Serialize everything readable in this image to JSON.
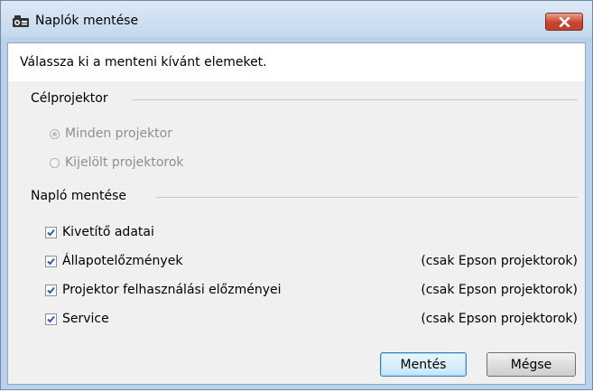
{
  "window": {
    "title": "Naplók mentése"
  },
  "instruction": "Válassza ki a menteni kívánt elemeket.",
  "target_group": {
    "label": "Célprojektor",
    "options": [
      {
        "label": "Minden projektor",
        "checked": true,
        "enabled": false
      },
      {
        "label": "Kijelölt projektorok",
        "checked": false,
        "enabled": false
      }
    ]
  },
  "log_group": {
    "label": "Napló mentése",
    "items": [
      {
        "label": "Kivetítő adatai",
        "checked": true,
        "note": ""
      },
      {
        "label": "Állapotelőzmények",
        "checked": true,
        "note": "(csak Epson projektorok)"
      },
      {
        "label": "Projektor felhasználási előzményei",
        "checked": true,
        "note": "(csak Epson projektorok)"
      },
      {
        "label": "Service",
        "checked": true,
        "note": "(csak Epson projektorok)"
      }
    ]
  },
  "buttons": {
    "save": "Mentés",
    "cancel": "Mégse"
  },
  "colors": {
    "accent": "#3c7fb1",
    "close": "#c8432c",
    "check": "#2b5fb4"
  }
}
